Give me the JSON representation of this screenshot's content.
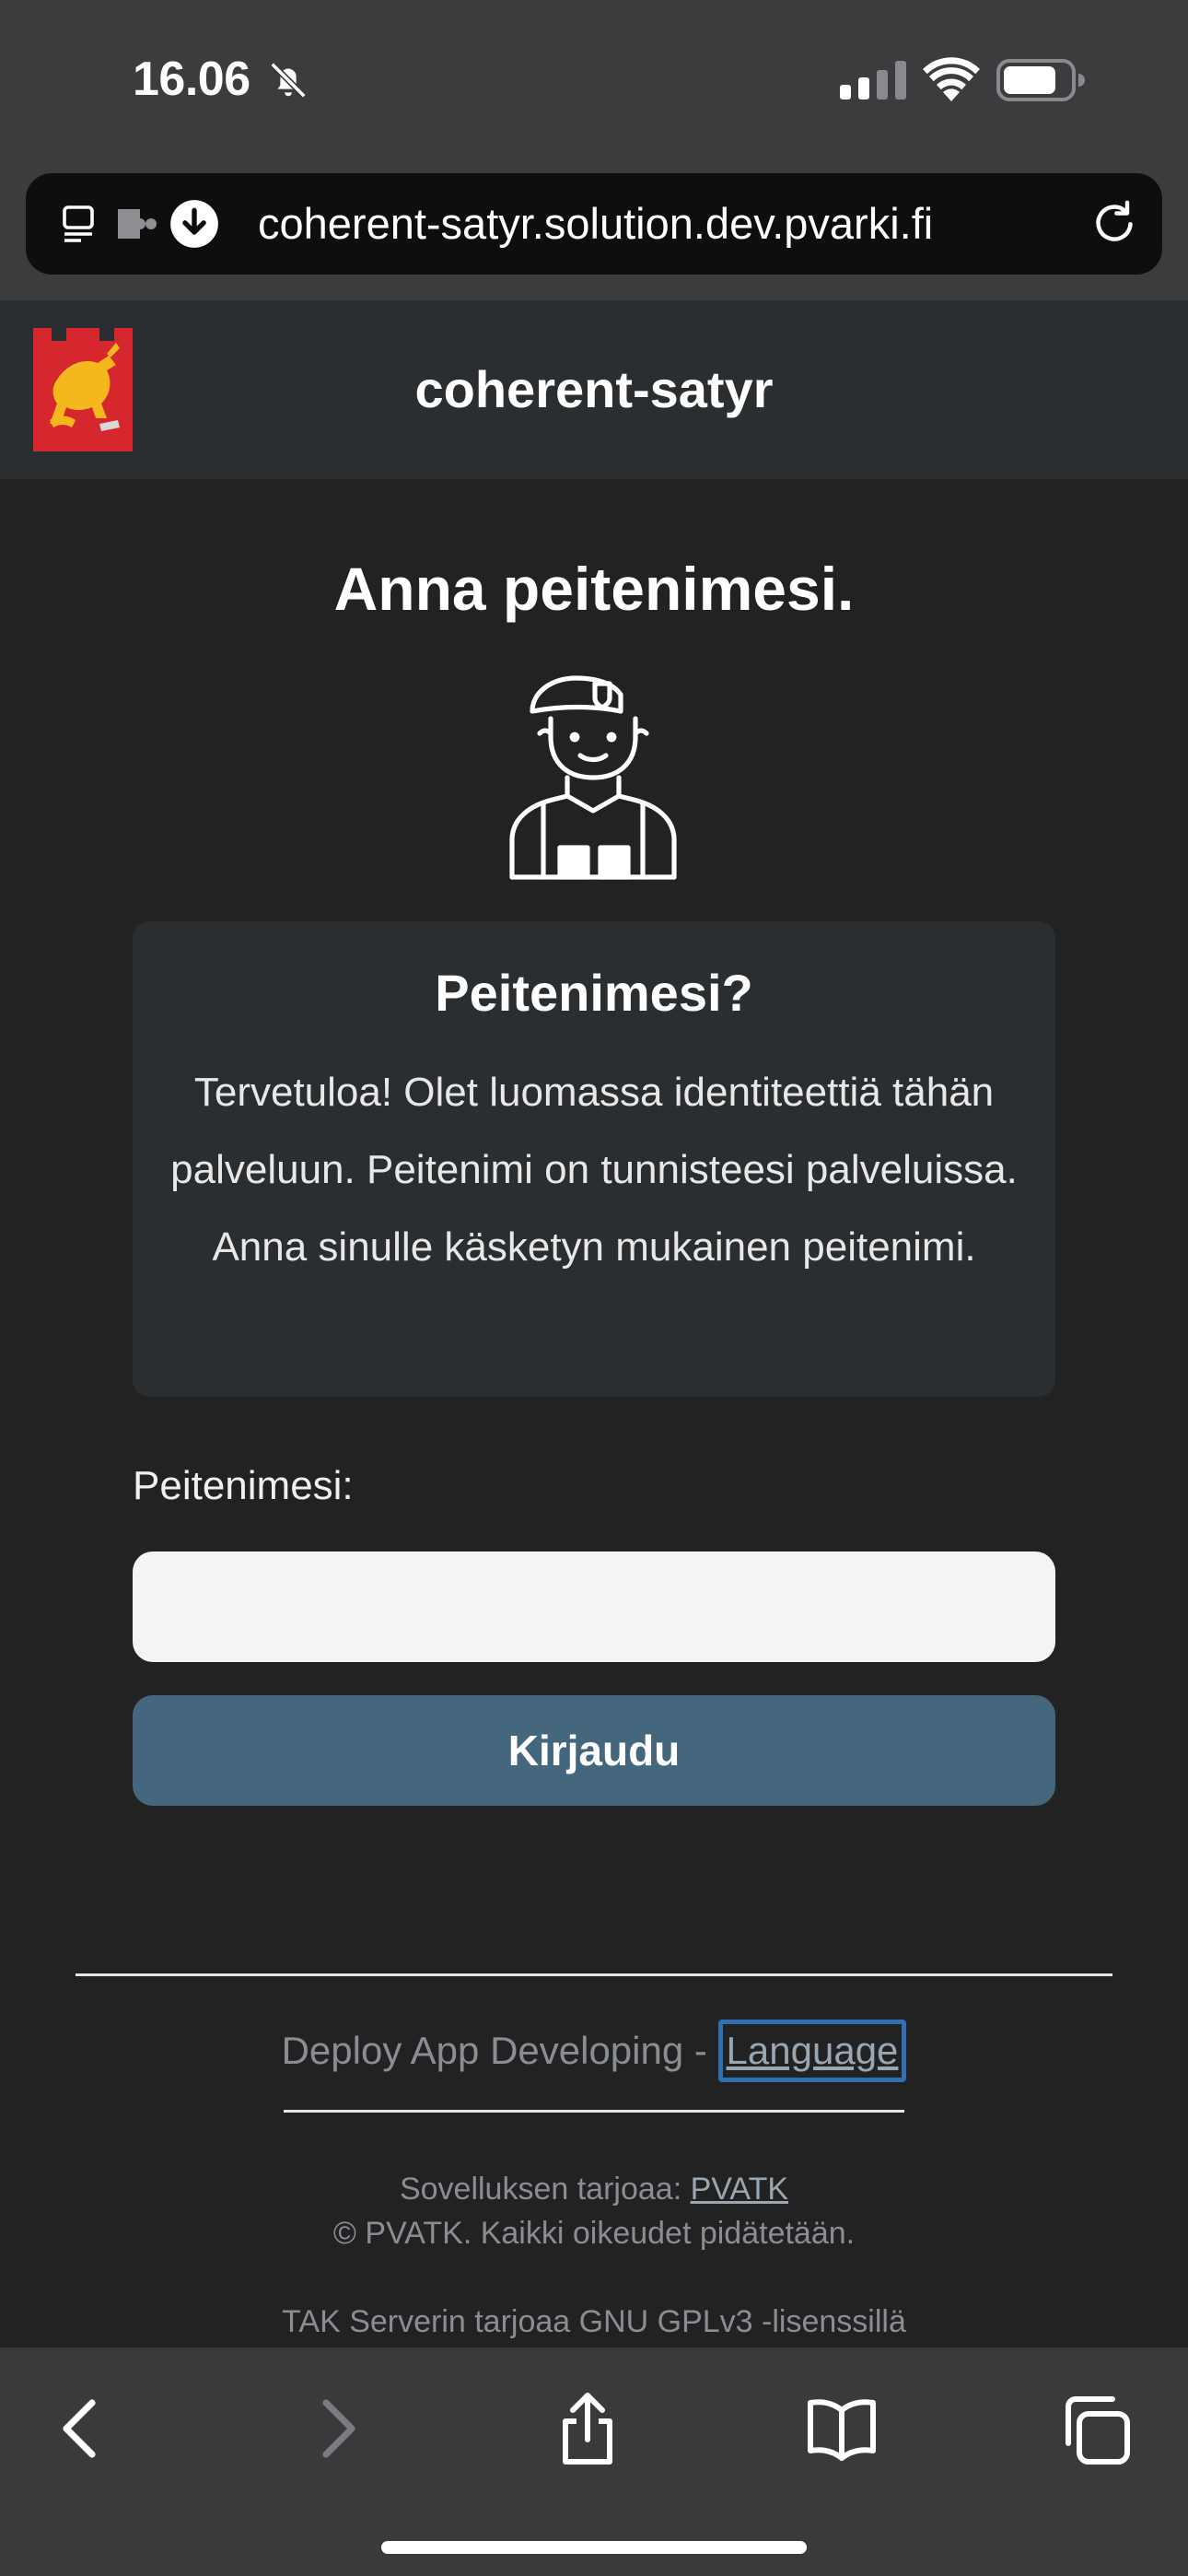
{
  "status_bar": {
    "time": "16.06"
  },
  "browser": {
    "url": "coherent-satyr.solution.dev.pvarki.fi"
  },
  "header": {
    "title": "coherent-satyr"
  },
  "main": {
    "heading": "Anna peitenimesi.",
    "card_title": "Peitenimesi?",
    "card_text": "Tervetuloa! Olet luomassa identiteettiä tähän palveluun. Peitenimi on tunnisteesi palveluissa. Anna sinulle käsketyn mukainen peitenimi.",
    "field_label": "Peitenimesi:",
    "input_value": "",
    "input_placeholder": "",
    "login_label": "Kirjaudu"
  },
  "footer": {
    "deploy_text": "Deploy App Developing - ",
    "language_link": "Language",
    "provider_prefix": "Sovelluksen tarjoaa: ",
    "provider_link": "PVATK",
    "copyright": "© PVATK. Kaikki oikeudet pidätetään.",
    "tak_text": "TAK Serverin tarjoaa GNU GPLv3 -lisenssillä"
  },
  "colors": {
    "page_background": "#222223",
    "header_background": "#2b2e30",
    "card_background": "#2b2e31",
    "login_button": "#44677d",
    "focus_outline": "#2f6fb2"
  },
  "icons": [
    "bell-off-icon",
    "signal-icon",
    "wifi-icon",
    "battery-icon",
    "reader-icon",
    "extension-icon",
    "download-icon",
    "reload-icon",
    "crest-logo",
    "soldier-avatar-icon",
    "back-icon",
    "forward-icon",
    "share-icon",
    "bookmarks-icon",
    "tabs-icon"
  ]
}
